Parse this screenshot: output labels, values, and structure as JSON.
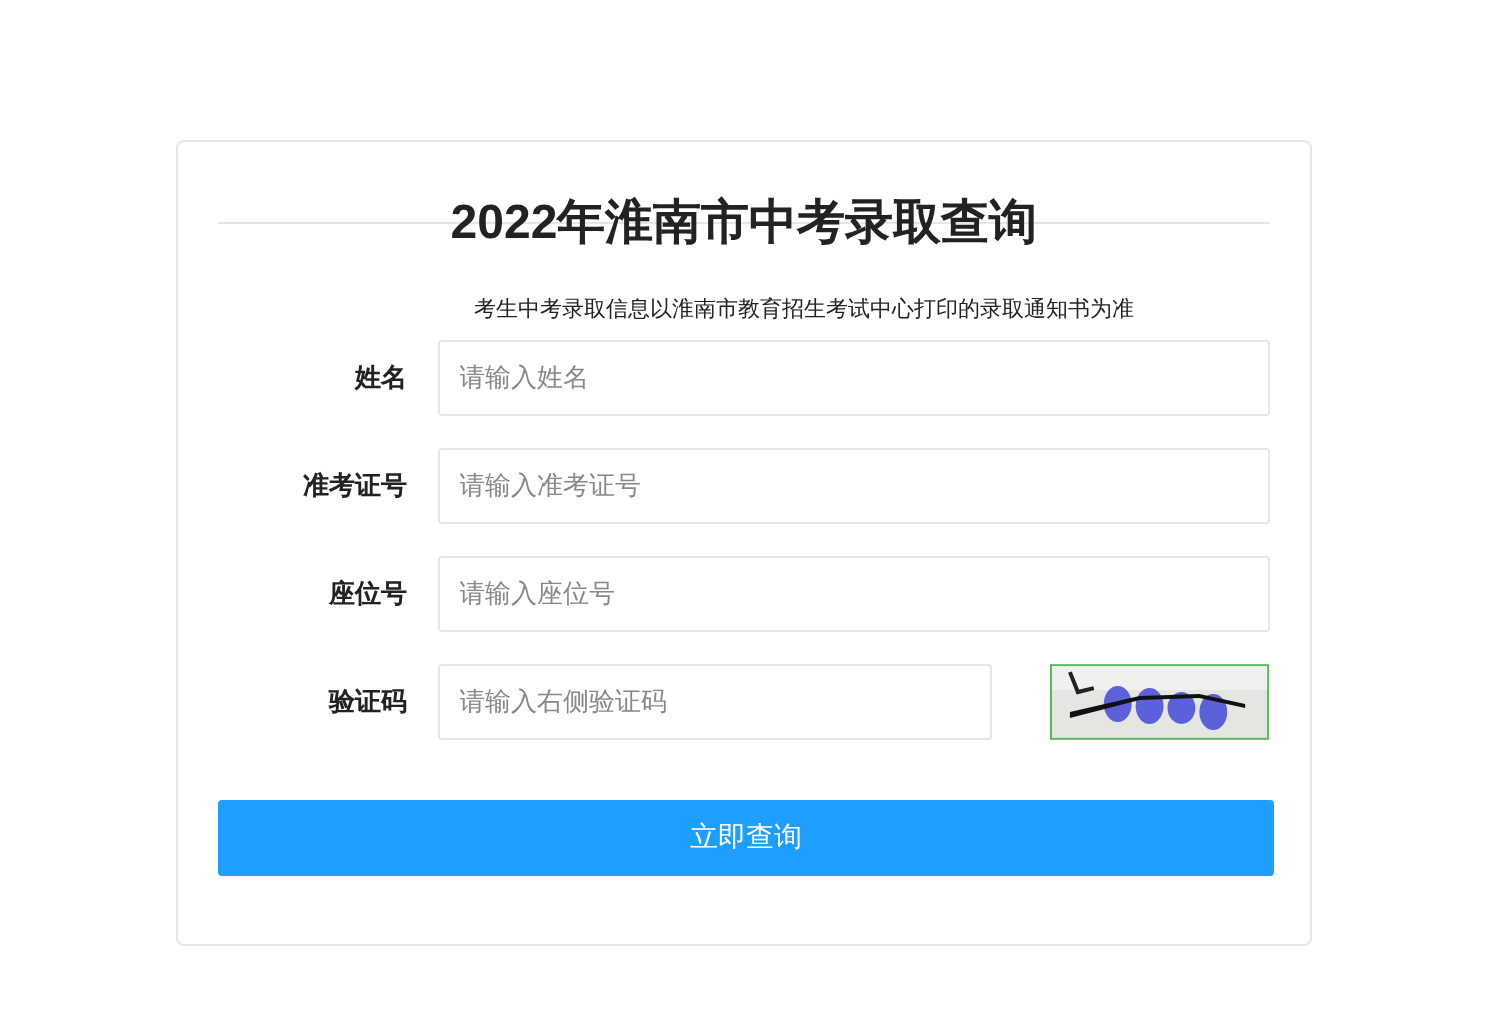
{
  "title": "2022年淮南市中考录取查询",
  "notice": "考生中考录取信息以淮南市教育招生考试中心打印的录取通知书为准",
  "fields": [
    {
      "label": "姓名",
      "placeholder": "请输入姓名",
      "kind": "text"
    },
    {
      "label": "准考证号",
      "placeholder": "请输入准考证号",
      "kind": "text"
    },
    {
      "label": "座位号",
      "placeholder": "请输入座位号",
      "kind": "text"
    },
    {
      "label": "验证码",
      "placeholder": "请输入右侧验证码",
      "kind": "captcha"
    }
  ],
  "submit": "立即查询"
}
